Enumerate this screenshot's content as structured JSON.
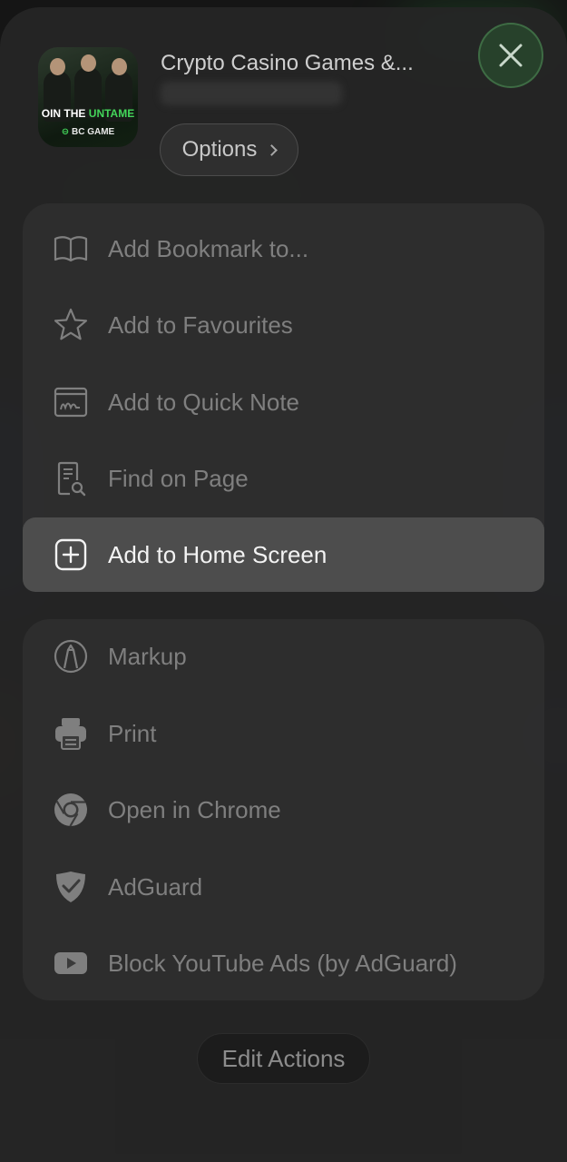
{
  "header": {
    "site_title": "Crypto Casino Games &...",
    "options_label": "Options",
    "thumb_banner_pre": "OIN THE ",
    "thumb_banner_hl": "UNTAME",
    "thumb_logo": "BC GAME"
  },
  "group_one": [
    {
      "label": "Add Bookmark to...",
      "icon": "book-icon"
    },
    {
      "label": "Add to Favourites",
      "icon": "star-icon"
    },
    {
      "label": "Add to Quick Note",
      "icon": "quick-note-icon"
    },
    {
      "label": "Find on Page",
      "icon": "find-document-icon"
    },
    {
      "label": "Add to Home Screen",
      "icon": "plus-square-icon",
      "active": true
    }
  ],
  "group_two": [
    {
      "label": "Markup",
      "icon": "markup-pen-icon"
    },
    {
      "label": "Print",
      "icon": "printer-icon"
    },
    {
      "label": "Open in Chrome",
      "icon": "chrome-icon"
    },
    {
      "label": "AdGuard",
      "icon": "shield-check-icon"
    },
    {
      "label": "Block YouTube Ads (by AdGuard)",
      "icon": "youtube-icon"
    }
  ],
  "footer": {
    "edit_actions_label": "Edit Actions"
  },
  "colors": {
    "sheet_bg": "#262626",
    "row_text": "#7f7f7f",
    "active_row_bg": "#4d4d4d",
    "active_row_text": "#f3f3f3",
    "close_bg": "#28462d",
    "brand_green": "#43d65a"
  }
}
